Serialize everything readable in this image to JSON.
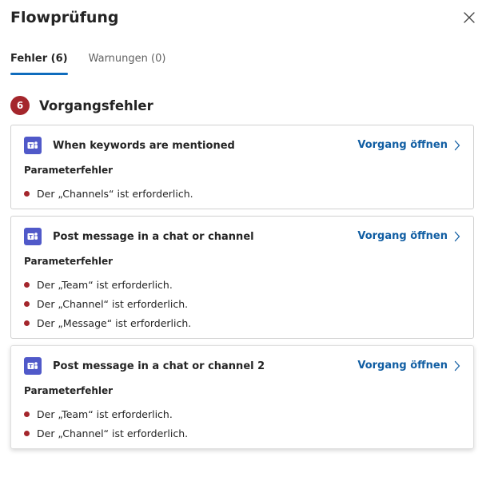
{
  "panel": {
    "title": "Flowprüfung"
  },
  "tabs": [
    {
      "label": "Fehler (6)",
      "active": true
    },
    {
      "label": "Warnungen (0)",
      "active": false
    }
  ],
  "section": {
    "count": "6",
    "title": "Vorgangsfehler"
  },
  "cards": [
    {
      "action": "When keywords are mentioned",
      "link": "Vorgang öffnen",
      "error_type": "Parameterfehler",
      "errors": [
        "Der „Channels“ ist erforderlich."
      ]
    },
    {
      "action": "Post message in a chat or channel",
      "link": "Vorgang öffnen",
      "error_type": "Parameterfehler",
      "errors": [
        "Der „Team“ ist erforderlich.",
        "Der „Channel“ ist erforderlich.",
        "Der „Message“ ist erforderlich."
      ]
    },
    {
      "action": "Post message in a chat or channel 2",
      "link": "Vorgang öffnen",
      "error_type": "Parameterfehler",
      "errors": [
        "Der „Team“ ist erforderlich.",
        "Der „Channel“ ist erforderlich."
      ]
    }
  ],
  "colors": {
    "accent": "#0f6cbd",
    "link": "#115ea3",
    "error": "#a4262c",
    "teams": "#5059c9"
  },
  "icons": {
    "close": "close-icon",
    "app": "microsoft-teams-icon",
    "chevron": "chevron-right-icon"
  }
}
